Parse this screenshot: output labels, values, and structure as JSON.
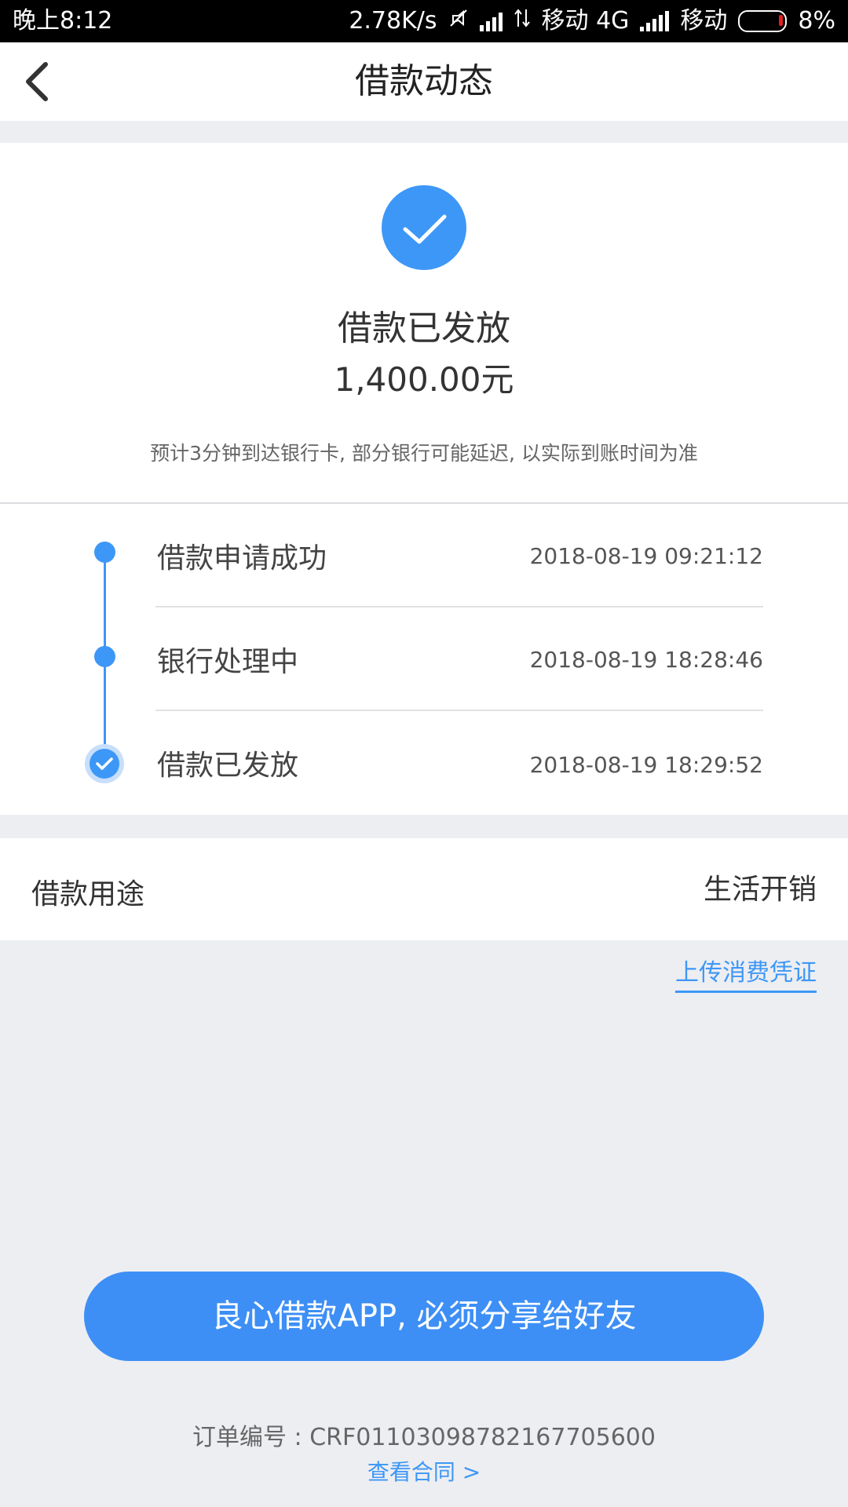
{
  "status_bar": {
    "time": "晚上8:12",
    "network_speed": "2.78K/s",
    "carrier1": "移动 4G",
    "carrier2": "移动",
    "battery": "8%"
  },
  "nav": {
    "title": "借款动态"
  },
  "status_card": {
    "title": "借款已发放",
    "amount": "1,400.00元",
    "note": "预计3分钟到达银行卡, 部分银行可能延迟, 以实际到账时间为准"
  },
  "timeline": {
    "steps": [
      {
        "label": "借款申请成功",
        "time": "2018-08-19 09:21:12"
      },
      {
        "label": "银行处理中",
        "time": "2018-08-19 18:28:46"
      },
      {
        "label": "借款已发放",
        "time": "2018-08-19 18:29:52"
      }
    ]
  },
  "purpose": {
    "label": "借款用途",
    "value": "生活开销"
  },
  "upload_link": "上传消费凭证",
  "share_button": "良心借款APP, 必须分享给好友",
  "footer": {
    "order_number": "订单编号 : CRF01103098782167705600",
    "contract_link": "查看合同 >"
  },
  "colors": {
    "accent": "#3D97F7",
    "background": "#EDEEF2"
  }
}
